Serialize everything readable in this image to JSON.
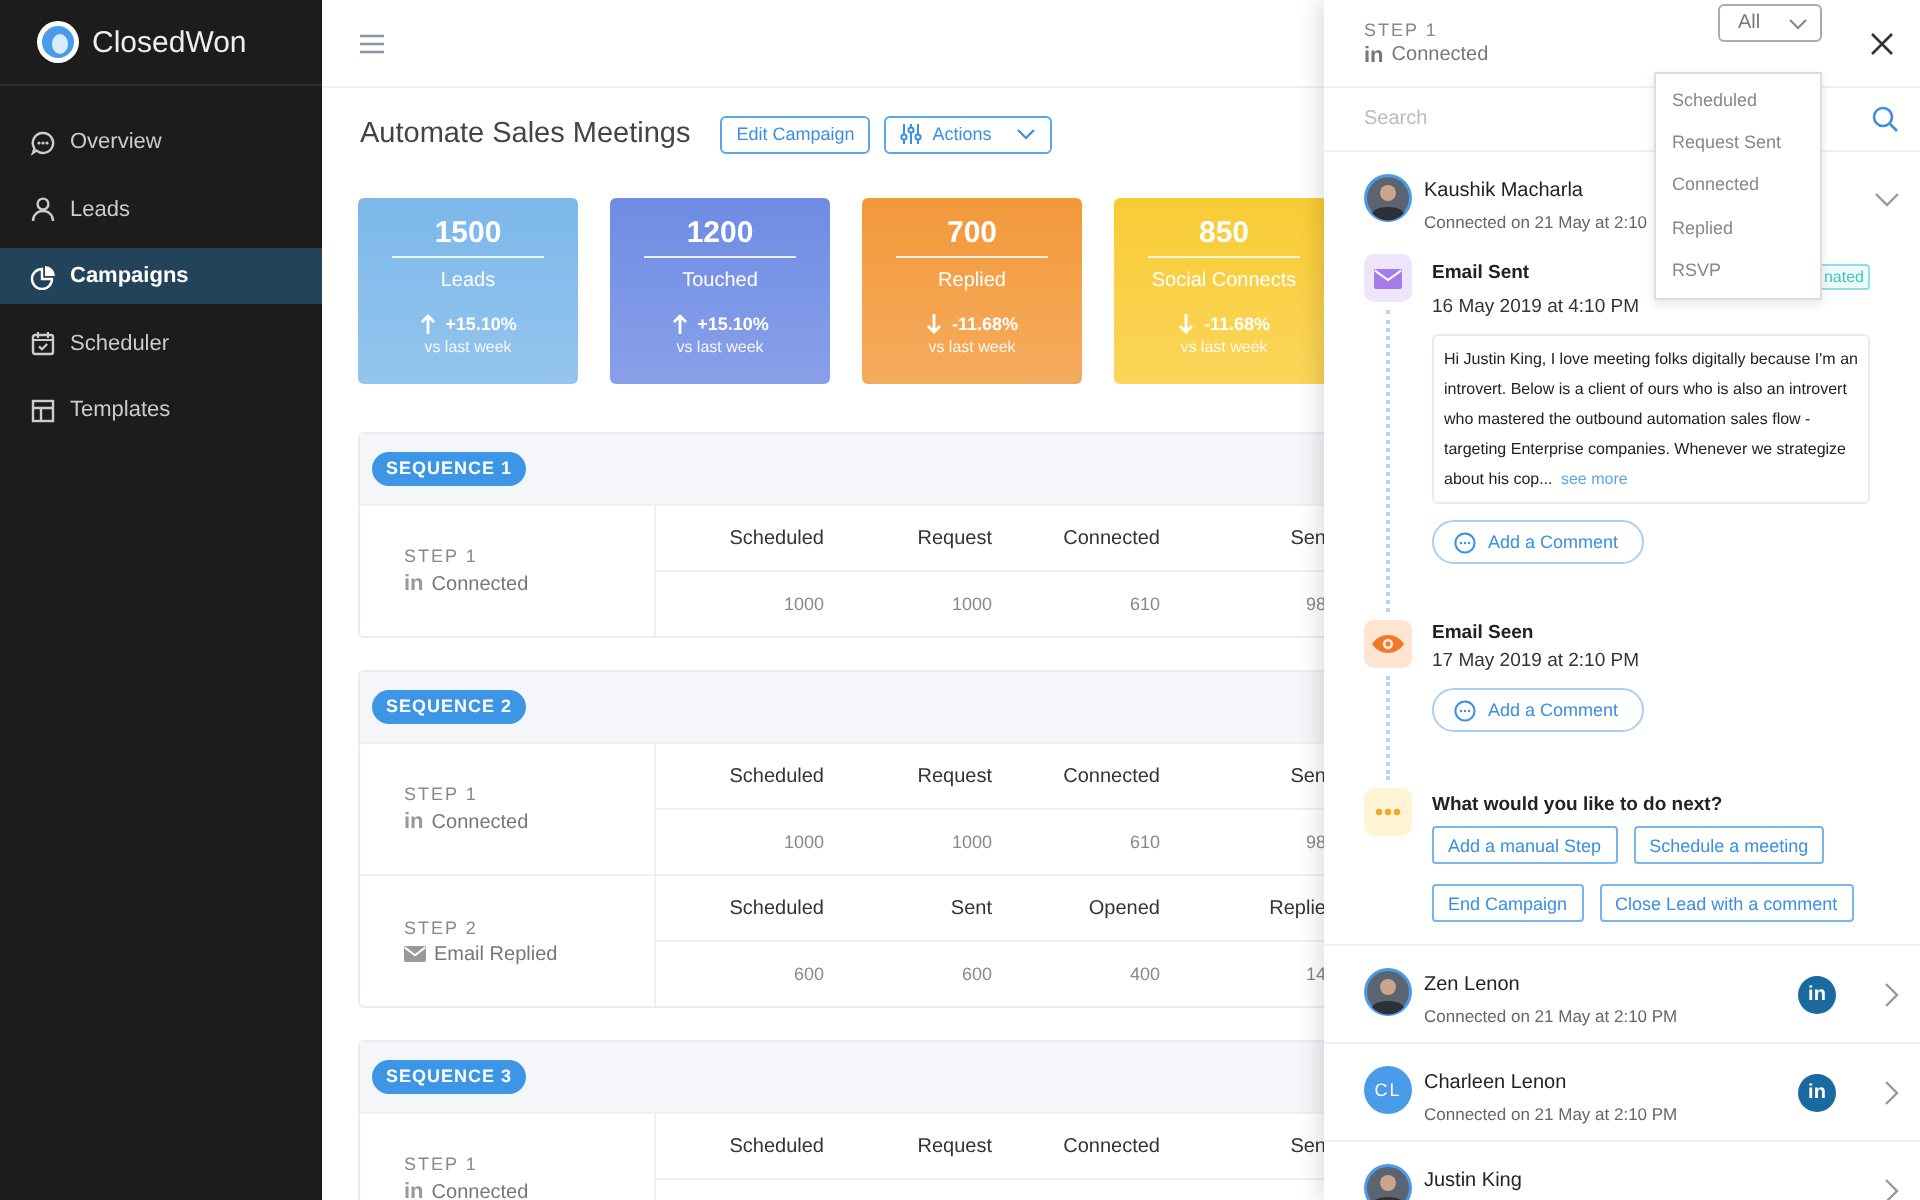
{
  "app": {
    "name": "ClosedWon"
  },
  "sidebar": {
    "items": [
      {
        "label": "Overview",
        "selected": false
      },
      {
        "label": "Leads",
        "selected": false
      },
      {
        "label": "Campaigns",
        "selected": true
      },
      {
        "label": "Scheduler",
        "selected": false
      },
      {
        "label": "Templates",
        "selected": false
      }
    ]
  },
  "page": {
    "title": "Automate Sales Meetings",
    "buttons": [
      {
        "label": "Edit Campaign",
        "kind": "plain"
      },
      {
        "label": "Actions",
        "kind": "menu"
      }
    ]
  },
  "stats": [
    {
      "value": "1500",
      "label": "Leads",
      "change": "+15.10%",
      "kind": "increase",
      "note": "vs last week",
      "color": "#7cb8ea"
    },
    {
      "value": "1200",
      "label": "Touched",
      "change": "+15.10%",
      "kind": "increase",
      "note": "vs last week",
      "color": "#6e8ce4"
    },
    {
      "value": "700",
      "label": "Replied",
      "change": "-11.68%",
      "kind": "decrease",
      "note": "vs last week",
      "color": "#f3993a"
    },
    {
      "value": "850",
      "label": "Social Connects",
      "change": "-11.68%",
      "kind": "decrease",
      "note": "vs last week",
      "color": "#f9cc35"
    }
  ],
  "sequences": [
    {
      "label": "SEQUENCE 1",
      "steps": [
        {
          "label": "STEP 1",
          "kind": "social",
          "mark": "in",
          "status": "Connected",
          "columns": [
            "Scheduled",
            "Request",
            "Connected",
            "Sen"
          ],
          "values": [
            "1000",
            "1000",
            "610",
            "98"
          ]
        }
      ]
    },
    {
      "label": "SEQUENCE 2",
      "steps": [
        {
          "label": "STEP 1",
          "kind": "social",
          "mark": "in",
          "status": "Connected",
          "columns": [
            "Scheduled",
            "Request",
            "Connected",
            "Sen"
          ],
          "values": [
            "1000",
            "1000",
            "610",
            "98"
          ]
        },
        {
          "label": "STEP 2",
          "kind": "email",
          "status": "Email Replied",
          "columns": [
            "Scheduled",
            "Sent",
            "Opened",
            "Replie"
          ],
          "values": [
            "600",
            "600",
            "400",
            "14"
          ]
        }
      ]
    },
    {
      "label": "SEQUENCE 3",
      "steps": [
        {
          "label": "STEP 1",
          "kind": "social",
          "mark": "in",
          "status": "Connected",
          "columns": [
            "Scheduled",
            "Request",
            "Connected",
            "Sen"
          ]
        }
      ]
    }
  ],
  "panel": {
    "step": "STEP 1",
    "mark": "in",
    "status": "Connected",
    "filter": {
      "value": "All",
      "expanded": true,
      "options": [
        "Scheduled",
        "Request Sent",
        "Connected",
        "Replied",
        "RSVP"
      ]
    },
    "search": {
      "placeholder": "Search"
    },
    "leads": [
      {
        "name": "Kaushik Macharla",
        "subtitle": "Connected on 21 May at 2:10",
        "kind": "photo",
        "expanded": true,
        "timeline": [
          {
            "kind": "email_sent",
            "title": "Email Sent",
            "time": "16 May 2019 at 4:10 PM",
            "badge": "nated",
            "message": "Hi Justin King, I love meeting folks digitally because I'm an introvert. Below is a client of ours who is also an introvert who mastered the outbound automation sales flow - targeting Enterprise companies. Whenever we strategize about his cop...",
            "link": "see more",
            "comment_button": "Add a Comment"
          },
          {
            "kind": "email_seen",
            "title": "Email Seen",
            "time": "17 May 2019 at 2:10 PM",
            "comment_button": "Add a Comment"
          },
          {
            "kind": "prompt",
            "title": "What would you like to do next?",
            "actions": [
              "Add a manual Step",
              "Schedule a meeting",
              "End Campaign",
              "Close Lead with a comment"
            ]
          }
        ]
      },
      {
        "name": "Zen Lenon",
        "subtitle": "Connected on 21 May at 2:10 PM",
        "kind": "photo",
        "badge": "in",
        "expanded": false
      },
      {
        "name": "Charleen Lenon",
        "subtitle": "Connected on 21 May at 2:10 PM",
        "kind": "initials",
        "initials": "CL",
        "badge": "in",
        "expanded": false
      },
      {
        "name": "Justin King",
        "kind": "photo",
        "expanded": false
      }
    ]
  }
}
